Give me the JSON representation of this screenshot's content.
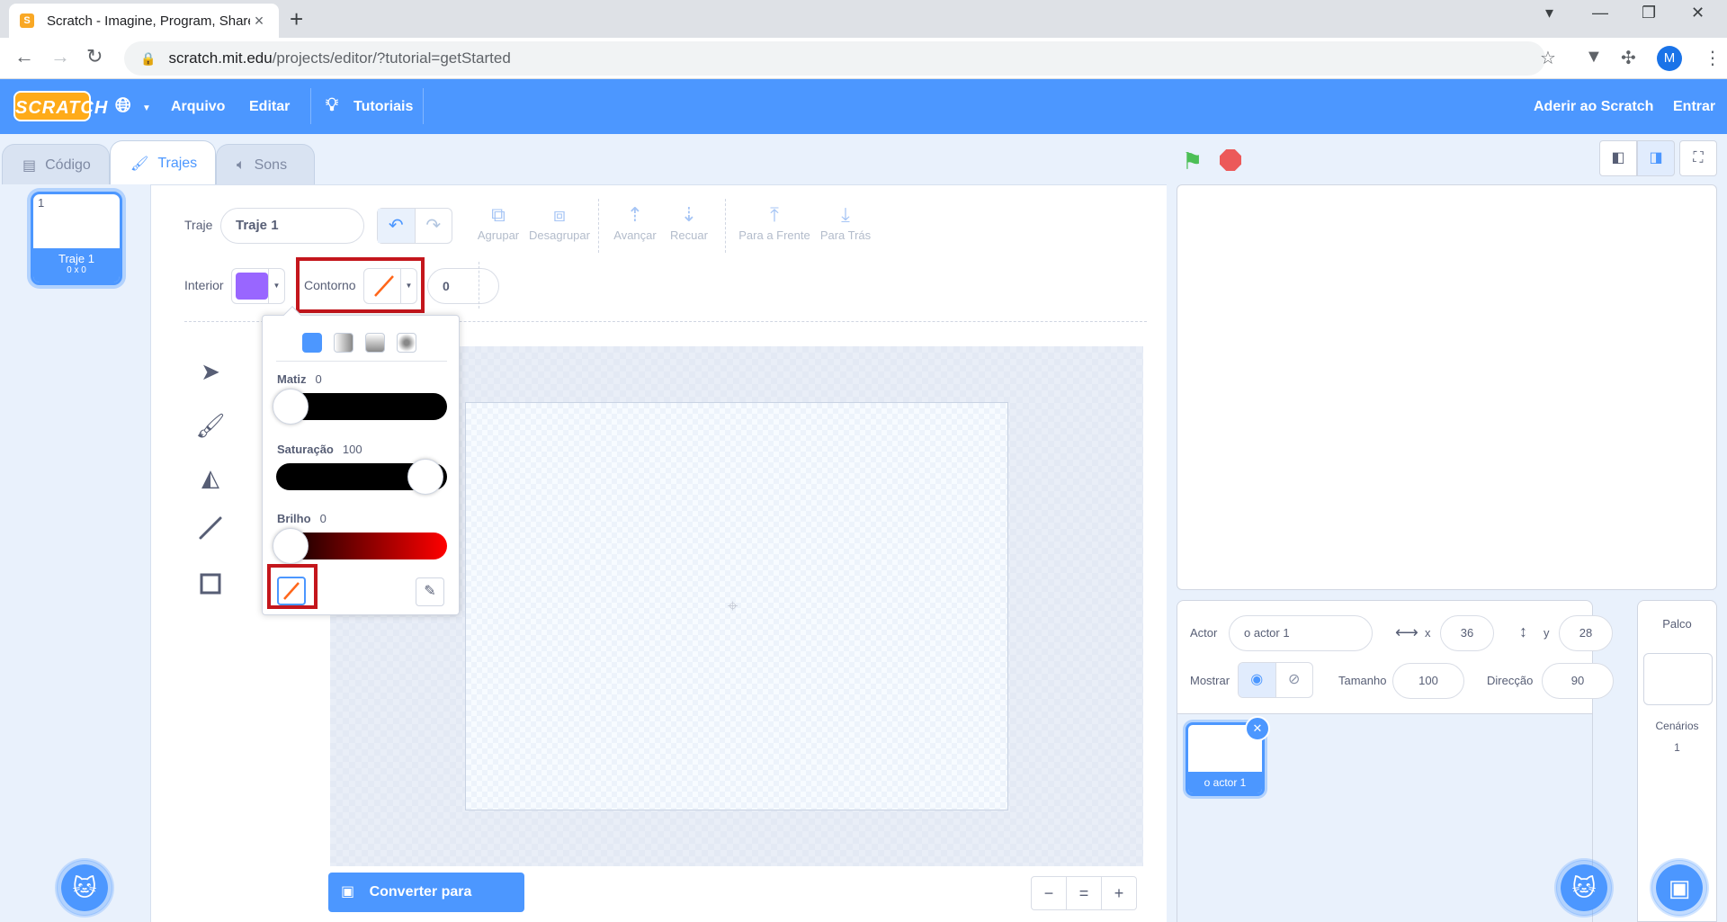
{
  "browser": {
    "tab_title": "Scratch - Imagine, Program, Share",
    "tab_close": "×",
    "new_tab": "+",
    "url_host": "scratch.mit.edu",
    "url_path": "/projects/editor/?tutorial=getStarted",
    "profile_initial": "M"
  },
  "menu": {
    "logo": "SCRATCH",
    "language_icon": "globe-icon",
    "file": "Arquivo",
    "edit": "Editar",
    "tutorials": "Tutoriais",
    "join": "Aderir ao Scratch",
    "signin": "Entrar"
  },
  "tabs": {
    "code": "Código",
    "costumes": "Trajes",
    "sounds": "Sons"
  },
  "costume_list": [
    {
      "number": "1",
      "name": "Traje 1",
      "size": "0 x 0"
    }
  ],
  "paint": {
    "costume_label": "Traje",
    "costume_name": "Traje 1",
    "group": "Agrupar",
    "ungroup": "Desagrupar",
    "forward": "Avançar",
    "backward": "Recuar",
    "front": "Para a Frente",
    "back": "Para Trás",
    "fill_label": "Interior",
    "fill_color": "#9966ff",
    "outline_label": "Contorno",
    "outline_width": "0",
    "convert_button": "Converter para Bitmap",
    "zoom_out": "−",
    "zoom_reset": "=",
    "zoom_in": "+"
  },
  "color_picker": {
    "hue_label": "Matiz",
    "hue_value": "0",
    "saturation_label": "Saturação",
    "saturation_value": "100",
    "brightness_label": "Brilho",
    "brightness_value": "0"
  },
  "sprite_info": {
    "sprite_label": "Actor",
    "sprite_name": "o actor 1",
    "x_label": "x",
    "x_value": "36",
    "y_label": "y",
    "y_value": "28",
    "show_label": "Mostrar",
    "size_label": "Tamanho",
    "size_value": "100",
    "direction_label": "Direcção",
    "direction_value": "90"
  },
  "sprites": [
    {
      "name": "o actor 1"
    }
  ],
  "stage_pane": {
    "title": "Palco",
    "backdrops_label": "Cenários",
    "backdrops_count": "1"
  },
  "colors": {
    "accent": "#4c97ff",
    "menu_bar": "#4c97ff",
    "highlight_box": "#c4161c",
    "go_flag": "#4cbf56",
    "stop": "#ec5959"
  }
}
